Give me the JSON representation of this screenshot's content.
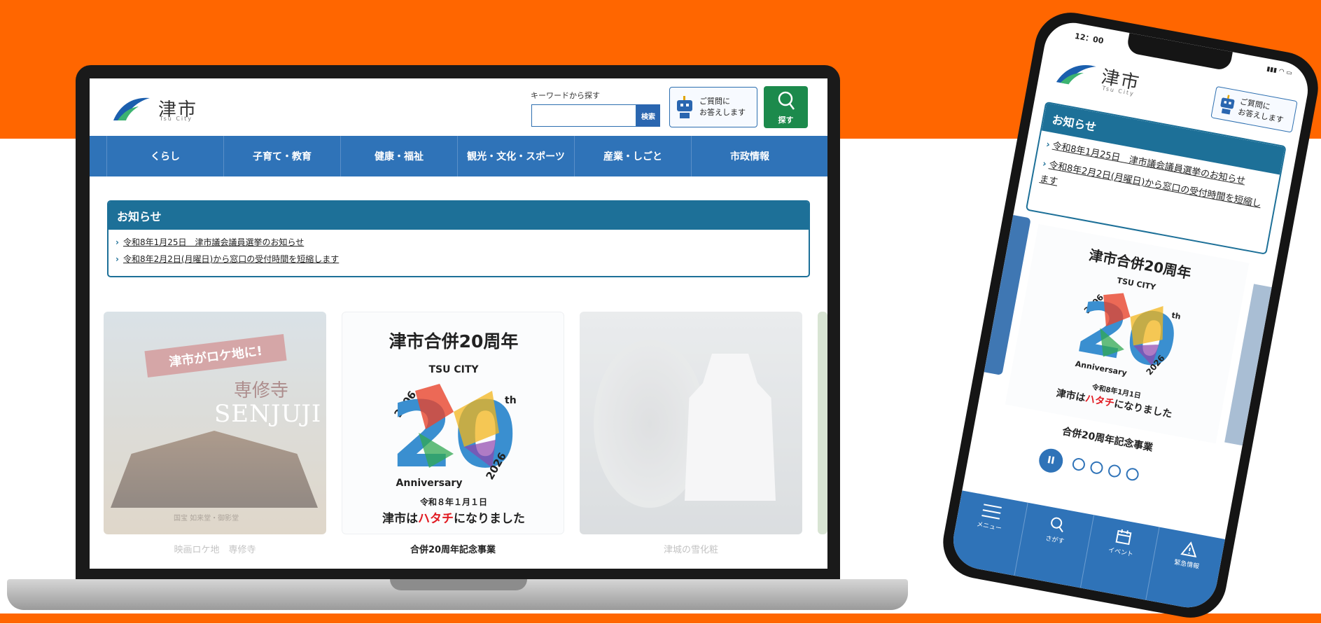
{
  "site": {
    "logo_title": "津市",
    "logo_sub": "Tsu City",
    "search_label": "キーワードから探す",
    "search_value": "",
    "search_button": "検索",
    "chat_line1": "ご質問に",
    "chat_line2": "お答えします",
    "search_big_label": "探す",
    "nav": [
      "くらし",
      "子育て・教育",
      "健康・福祉",
      "観光・文化・スポーツ",
      "産業・しごと",
      "市政情報"
    ],
    "notice_title": "お知らせ",
    "notices": [
      "令和8年1月25日　津市議会議員選挙のお知らせ",
      "令和8年2月2日(月曜日)から窓口の受付時間を短縮します"
    ],
    "cards": [
      {
        "banner": "津市がロケ地に!",
        "temple": "専修寺",
        "roman": "SENJUJI",
        "small": "国宝 如来堂・御影堂",
        "caption": "映画ロケ地　専修寺"
      },
      {
        "title": "津市合併20周年",
        "logo_top": "TSU CITY",
        "logo_year_left": "2006",
        "logo_year_right": "2026",
        "logo_big": "20",
        "logo_th": "th",
        "logo_anniv": "Anniversary",
        "date": "令和８年１月１日",
        "hachi_prefix": "津市は",
        "hachi_red": "ハタチ",
        "hachi_suffix": "になりました",
        "caption": "合併20周年記念事業"
      },
      {
        "caption": "津城の雪化粧"
      }
    ]
  },
  "phone": {
    "time": "12：00",
    "logo_title": "津市",
    "logo_sub": "Tsu City",
    "chat_line1": "ご質問に",
    "chat_line2": "お答えします",
    "notice_title": "お知らせ",
    "notices": [
      "令和8年1月25日　津市議会議員選挙のお知らせ",
      "令和8年2月2日(月曜日)から窓口の受付時間を短縮します"
    ],
    "slide_title": "津市合併20周年",
    "slide_date": "令和8年1月1日",
    "slide_hachi_prefix": "津市は",
    "slide_hachi_red": "ハタチ",
    "slide_hachi_suffix": "になりました",
    "caption": "合併20周年記念事業",
    "pause_label": "II",
    "tabs": [
      "メニュー",
      "さがす",
      "イベント",
      "緊急情報"
    ]
  },
  "colors": {
    "orange": "#ff6600",
    "nav_blue": "#2f73b8",
    "notice_teal": "#1d7098",
    "search_green": "#1c8a4c",
    "accent_red": "#e11b22"
  }
}
